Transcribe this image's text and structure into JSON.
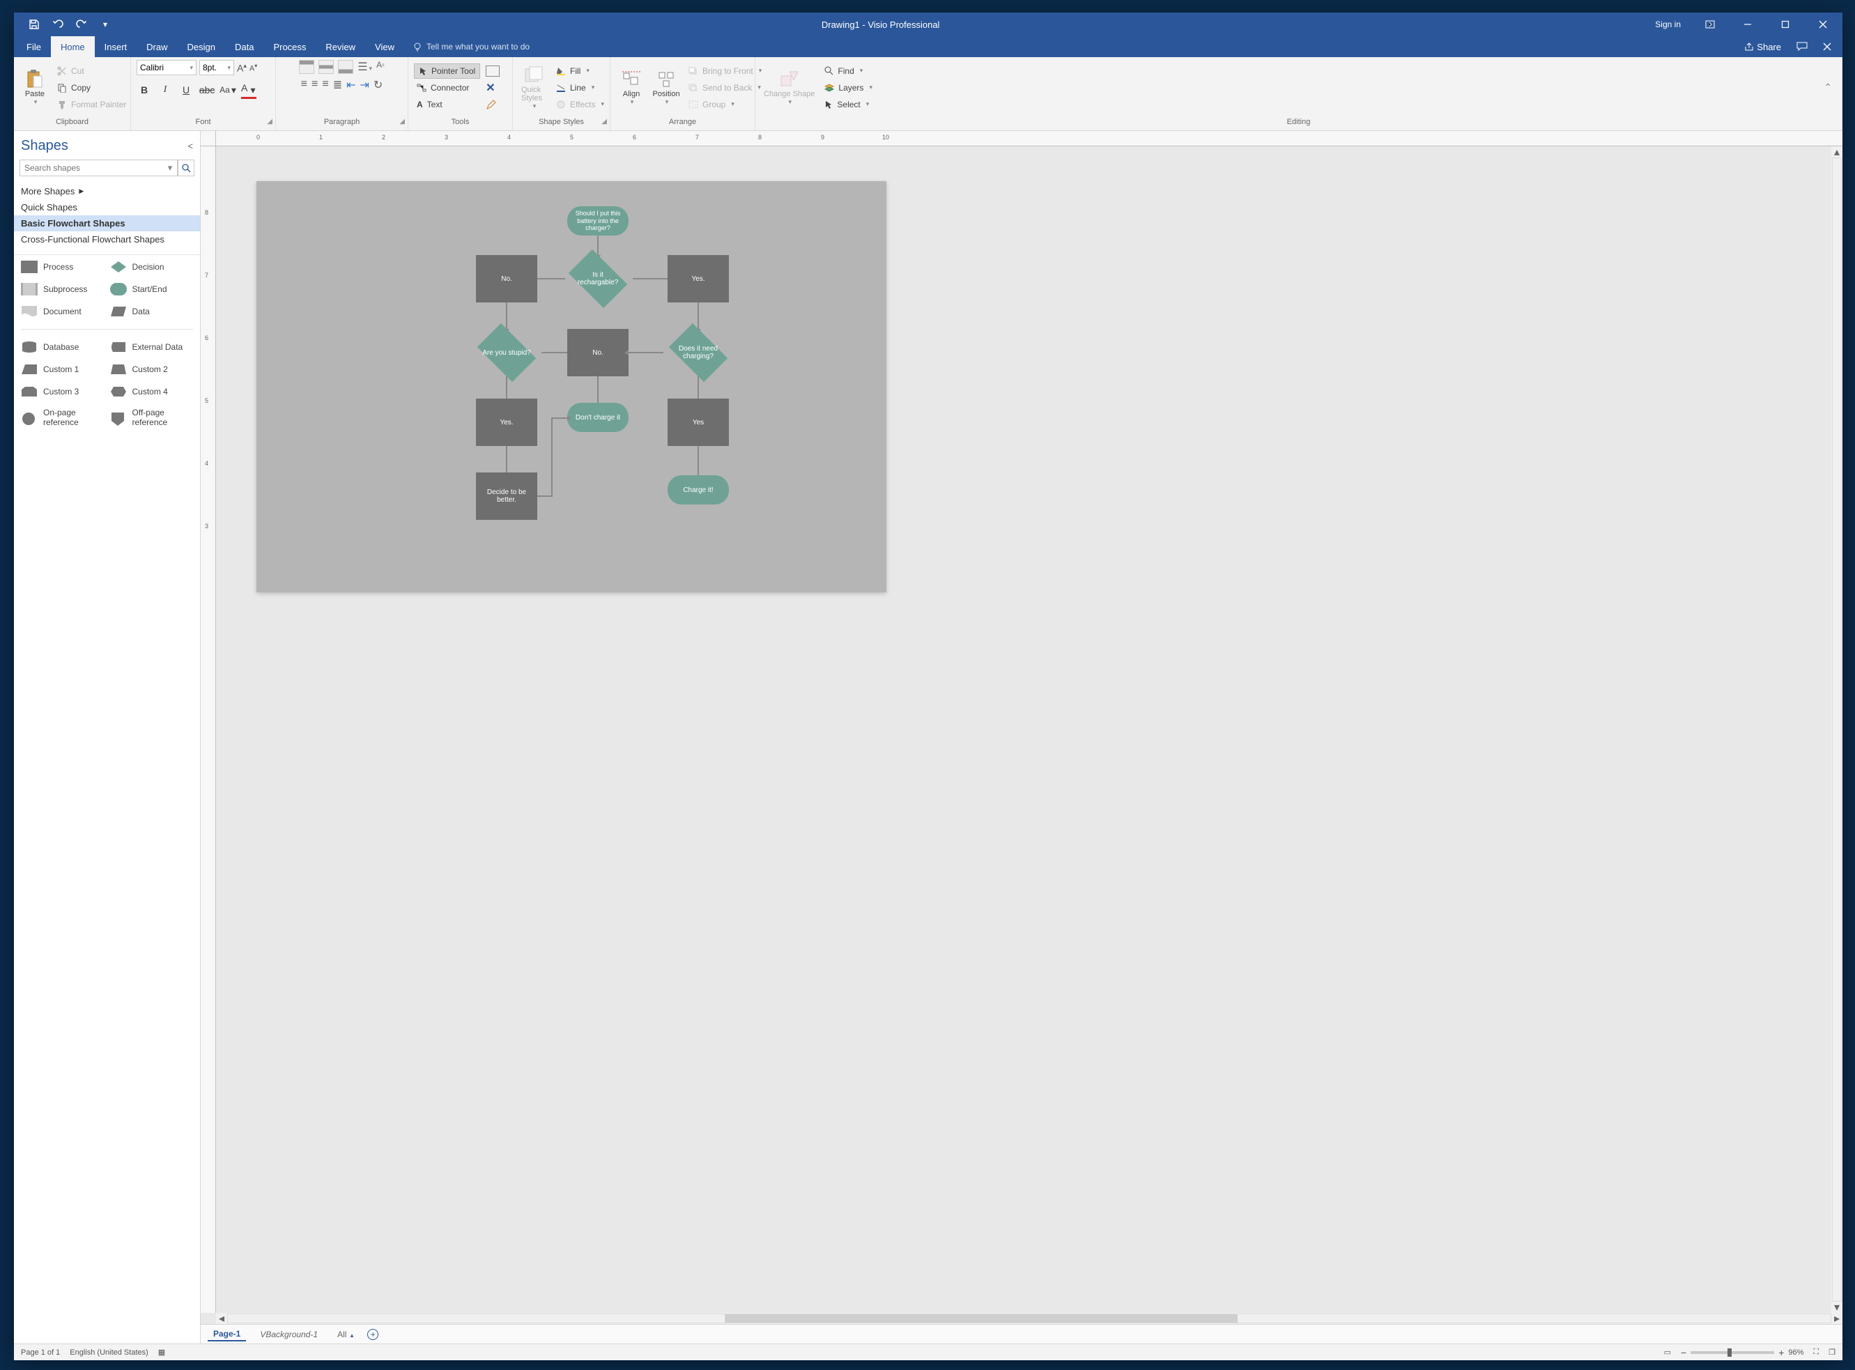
{
  "title": {
    "doc": "Drawing1",
    "sep": "  -  ",
    "app": "Visio Professional"
  },
  "signin": "Sign in",
  "tabs": [
    "File",
    "Home",
    "Insert",
    "Draw",
    "Design",
    "Data",
    "Process",
    "Review",
    "View"
  ],
  "active_tab": "Home",
  "tellme": "Tell me what you want to do",
  "share": "Share",
  "ribbon": {
    "clipboard": {
      "paste": "Paste",
      "cut": "Cut",
      "copy": "Copy",
      "painter": "Format Painter",
      "label": "Clipboard"
    },
    "font": {
      "name": "Calibri",
      "size": "8pt.",
      "label": "Font"
    },
    "paragraph": {
      "label": "Paragraph"
    },
    "tools": {
      "pointer": "Pointer Tool",
      "connector": "Connector",
      "text": "Text",
      "label": "Tools"
    },
    "styles": {
      "quick": "Quick Styles",
      "fill": "Fill",
      "line": "Line",
      "effects": "Effects",
      "label": "Shape Styles"
    },
    "arrange": {
      "align": "Align",
      "position": "Position",
      "btf": "Bring to Front",
      "stb": "Send to Back",
      "group": "Group",
      "label": "Arrange"
    },
    "editing": {
      "change": "Change Shape",
      "find": "Find",
      "layers": "Layers",
      "select": "Select",
      "label": "Editing"
    }
  },
  "shapes_pane": {
    "title": "Shapes",
    "search_placeholder": "Search shapes",
    "more": "More Shapes",
    "stencils": [
      "Quick Shapes",
      "Basic Flowchart Shapes",
      "Cross-Functional Flowchart Shapes"
    ],
    "selected_stencil": "Basic Flowchart Shapes",
    "shapes": [
      "Process",
      "Decision",
      "Subprocess",
      "Start/End",
      "Document",
      "Data",
      "Database",
      "External Data",
      "Custom 1",
      "Custom 2",
      "Custom 3",
      "Custom 4",
      "On-page reference",
      "Off-page reference"
    ]
  },
  "ruler_h": [
    "0",
    "1",
    "2",
    "3",
    "4",
    "5",
    "6",
    "7",
    "8",
    "9",
    "10"
  ],
  "ruler_v": [
    "8",
    "7",
    "6",
    "5",
    "4",
    "3"
  ],
  "flowchart": {
    "start": "Should I put this battery into the charger?",
    "d1": "Is it rechargable?",
    "p_no1": "No.",
    "p_yes1": "Yes.",
    "d2": "Are you stupid?",
    "d3": "Does it need charging?",
    "p_no2": "No.",
    "t_dont": "Don't charge it",
    "p_yes2": "Yes.",
    "p_yes3": "Yes",
    "p_decide": "Decide to be better.",
    "t_charge": "Charge it!"
  },
  "page_tabs": {
    "p1": "Page-1",
    "bg": "VBackground-1",
    "all": "All"
  },
  "status": {
    "page": "Page 1 of 1",
    "lang": "English (United States)",
    "zoom": "96%"
  }
}
